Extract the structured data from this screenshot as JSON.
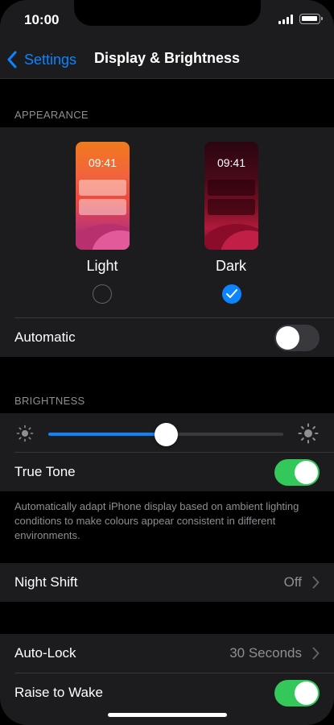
{
  "status": {
    "time": "10:00"
  },
  "nav": {
    "back_label": "Settings",
    "title": "Display & Brightness"
  },
  "appearance": {
    "header": "APPEARANCE",
    "light": {
      "label": "Light",
      "preview_time": "09:41",
      "selected": false
    },
    "dark": {
      "label": "Dark",
      "preview_time": "09:41",
      "selected": true
    },
    "automatic": {
      "label": "Automatic",
      "on": false
    }
  },
  "brightness": {
    "header": "BRIGHTNESS",
    "level": 0.5,
    "true_tone": {
      "label": "True Tone",
      "on": true
    },
    "note": "Automatically adapt iPhone display based on ambient lighting conditions to make colours appear consistent in different environments."
  },
  "night_shift": {
    "label": "Night Shift",
    "value": "Off"
  },
  "auto_lock": {
    "label": "Auto-Lock",
    "value": "30 Seconds"
  },
  "raise_to_wake": {
    "label": "Raise to Wake",
    "on": true
  },
  "colors": {
    "accent": "#0a84ff",
    "toggle_on": "#34c759",
    "background": "#000000",
    "cell": "#1c1c1e"
  }
}
